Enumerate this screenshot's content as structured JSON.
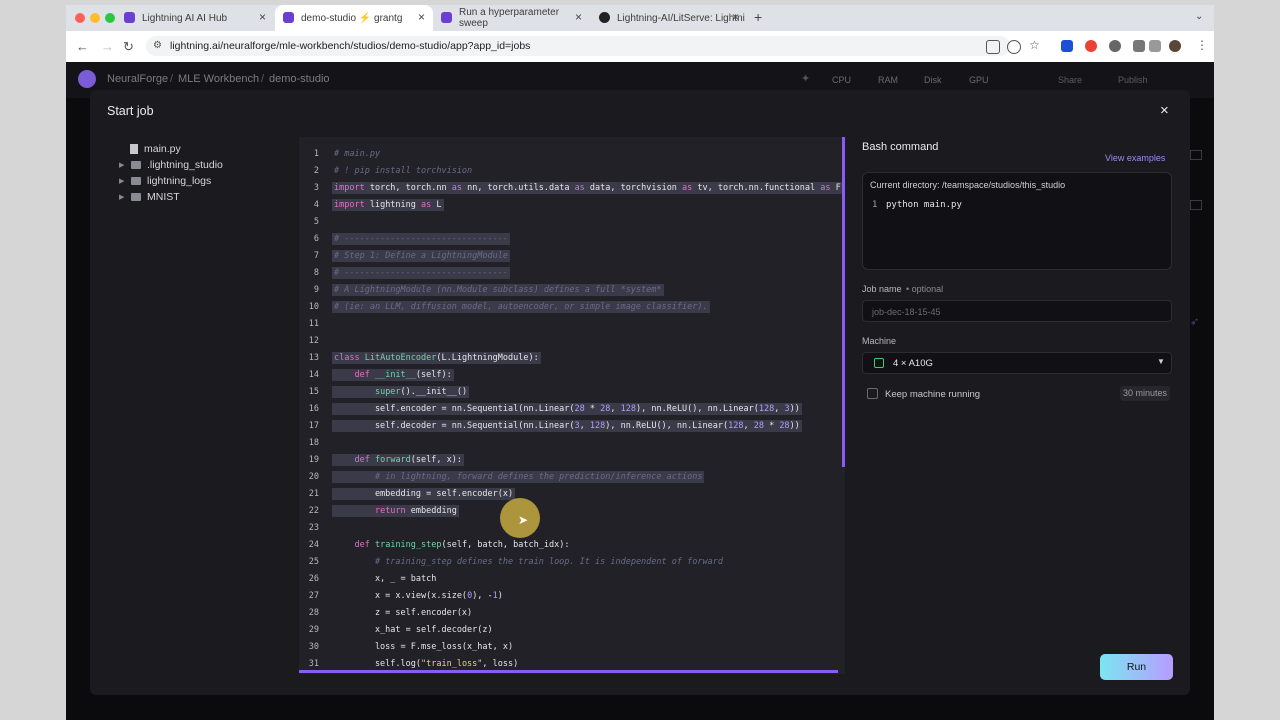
{
  "browser": {
    "tabs": [
      {
        "title": "Lightning AI AI Hub"
      },
      {
        "title": "demo-studio ⚡ grantg"
      },
      {
        "title": "Run a hyperparameter sweep"
      },
      {
        "title": "Lightning-AI/LitServe: Lightni"
      }
    ],
    "new_tab": "+",
    "url": "lightning.ai/neuralforge/mle-workbench/studios/demo-studio/app?app_id=jobs"
  },
  "app": {
    "breadcrumb": [
      "NeuralForge",
      "MLE Workbench",
      "demo-studio"
    ],
    "sep": "/",
    "metrics": [
      "CPU",
      "RAM",
      "Disk",
      "GPU"
    ],
    "share": "Share",
    "publish": "Publish"
  },
  "modal": {
    "title": "Start job",
    "close": "×",
    "files": [
      {
        "name": "main.py",
        "type": "file"
      },
      {
        "name": ".lightning_studio",
        "type": "folder"
      },
      {
        "name": "lightning_logs",
        "type": "folder"
      },
      {
        "name": "MNIST",
        "type": "folder"
      }
    ],
    "bash": {
      "title": "Bash command",
      "view_examples": "View examples",
      "current_dir": "Current directory: /teamspace/studios/this_studio",
      "line_no": "1",
      "command": "python main.py"
    },
    "job_name": {
      "label": "Job name",
      "optional": "• optional",
      "placeholder": "job-dec-18-15-45"
    },
    "machine": {
      "label": "Machine",
      "value": "4 × A10G"
    },
    "keep_running": {
      "label": "Keep machine running",
      "duration": "30 minutes"
    },
    "run": "Run"
  },
  "colors": {
    "accent": "#8a5cf5",
    "run_gradient": [
      "#7be6f0",
      "#b79cff"
    ]
  }
}
